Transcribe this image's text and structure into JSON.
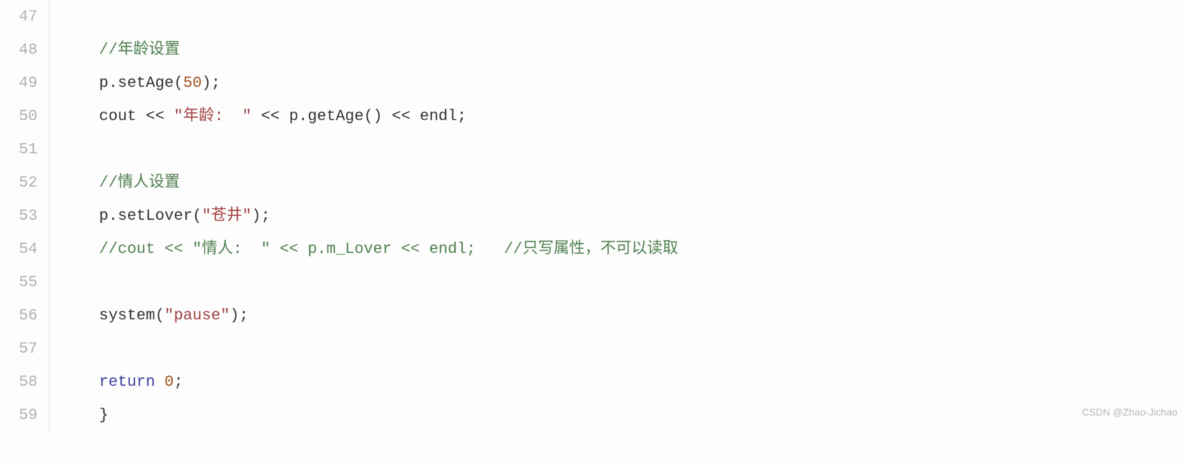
{
  "lines": [
    {
      "num": "47",
      "tokens": []
    },
    {
      "num": "48",
      "tokens": [
        {
          "cls": "comment",
          "t": "//年龄设置"
        }
      ]
    },
    {
      "num": "49",
      "tokens": [
        {
          "cls": "",
          "t": "p.setAge("
        },
        {
          "cls": "number",
          "t": "50"
        },
        {
          "cls": "",
          "t": ");"
        }
      ]
    },
    {
      "num": "50",
      "tokens": [
        {
          "cls": "",
          "t": "cout << "
        },
        {
          "cls": "string",
          "t": "\"年龄:  \""
        },
        {
          "cls": "",
          "t": " << p.getAge() << endl;"
        }
      ]
    },
    {
      "num": "51",
      "tokens": []
    },
    {
      "num": "52",
      "tokens": [
        {
          "cls": "comment",
          "t": "//情人设置"
        }
      ]
    },
    {
      "num": "53",
      "tokens": [
        {
          "cls": "",
          "t": "p.setLover("
        },
        {
          "cls": "string",
          "t": "\"苍井\""
        },
        {
          "cls": "",
          "t": ");"
        }
      ]
    },
    {
      "num": "54",
      "tokens": [
        {
          "cls": "comment",
          "t": "//cout << \"情人:  \" << p.m_Lover << endl;   //只写属性，不可以读取"
        }
      ]
    },
    {
      "num": "55",
      "tokens": []
    },
    {
      "num": "56",
      "tokens": [
        {
          "cls": "",
          "t": "system("
        },
        {
          "cls": "string",
          "t": "\"pause\""
        },
        {
          "cls": "",
          "t": ");"
        }
      ]
    },
    {
      "num": "57",
      "tokens": []
    },
    {
      "num": "58",
      "tokens": [
        {
          "cls": "keyword",
          "t": "return"
        },
        {
          "cls": "",
          "t": " "
        },
        {
          "cls": "number",
          "t": "0"
        },
        {
          "cls": "",
          "t": ";"
        }
      ]
    },
    {
      "num": "59",
      "tokens": [
        {
          "cls": "",
          "t": "}",
          "noindent": true
        }
      ]
    }
  ],
  "watermark": "CSDN @Zhao-Jichao"
}
